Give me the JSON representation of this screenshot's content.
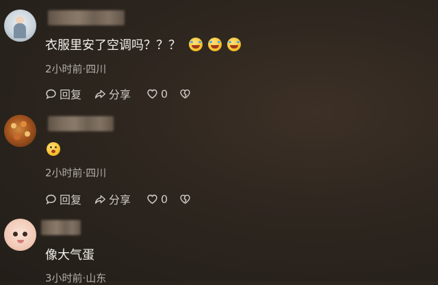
{
  "comments": [
    {
      "text": "衣服里安了空调吗？？？",
      "emojis": [
        "laughing-tears-emoji",
        "laughing-tears-emoji",
        "laughing-tears-emoji"
      ],
      "meta": "2小时前·四川",
      "reply_label": "回复",
      "share_label": "分享",
      "like_count": "0"
    },
    {
      "text": "",
      "emojis": [
        "flushed-emoji"
      ],
      "meta": "2小时前·四川",
      "reply_label": "回复",
      "share_label": "分享",
      "like_count": "0"
    },
    {
      "text": "像大气蛋",
      "emojis": [],
      "meta": "3小时前·山东"
    }
  ],
  "icons": [
    "comment-bubble-icon",
    "share-arrow-icon",
    "heart-icon",
    "broken-heart-icon"
  ]
}
